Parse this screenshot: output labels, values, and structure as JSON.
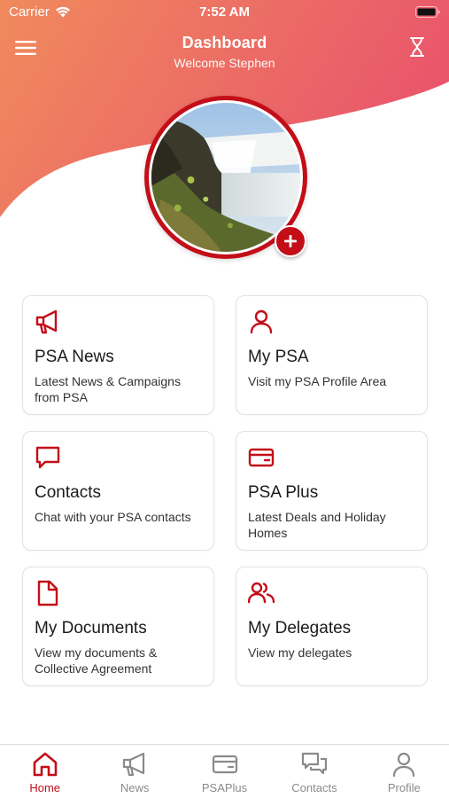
{
  "status_bar": {
    "carrier": "Carrier",
    "time": "7:52 AM"
  },
  "header": {
    "title": "Dashboard",
    "subtitle": "Welcome Stephen",
    "gradient_start": "#f08a5d",
    "gradient_end": "#e9566b"
  },
  "accent_color": "#c30e18",
  "profile": {
    "add_photo_icon": "plus-icon"
  },
  "cards": [
    {
      "icon": "megaphone-icon",
      "title": "PSA News",
      "description": "Latest News & Campaigns from PSA"
    },
    {
      "icon": "person-icon",
      "title": "My PSA",
      "description": "Visit my PSA Profile Area"
    },
    {
      "icon": "chat-bubble-icon",
      "title": "Contacts",
      "description": "Chat with your PSA contacts"
    },
    {
      "icon": "card-icon",
      "title": "PSA Plus",
      "description": "Latest Deals and Holiday Homes"
    },
    {
      "icon": "document-icon",
      "title": "My Documents",
      "description": "View my documents & Collective Agreement"
    },
    {
      "icon": "people-icon",
      "title": "My Delegates",
      "description": "View my delegates"
    }
  ],
  "tabs": [
    {
      "icon": "home-icon",
      "label": "Home",
      "active": true
    },
    {
      "icon": "megaphone-icon",
      "label": "News",
      "active": false
    },
    {
      "icon": "card-icon",
      "label": "PSAPlus",
      "active": false
    },
    {
      "icon": "chat-bubbles-icon",
      "label": "Contacts",
      "active": false
    },
    {
      "icon": "person-icon",
      "label": "Profile",
      "active": false
    }
  ]
}
